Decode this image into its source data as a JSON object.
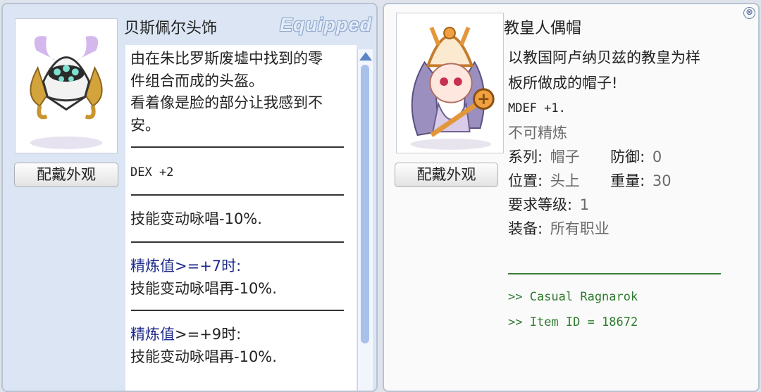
{
  "left": {
    "icon": "helmet-icon",
    "button_label": "配戴外观",
    "title": "贝斯佩尔头饰",
    "badge": "Equipped",
    "description": [
      "由在朱比罗斯废墟中找到的零",
      "件组合而成的头盔。",
      "看着像是脸的部分让我感到不",
      "安。"
    ],
    "stat": "DEX  +2",
    "effect": "技能变动咏唱-10%.",
    "refine1_label": "精炼值",
    "refine1_cond": ">=+7时:",
    "refine1_effect": "技能变动咏唱再-10%.",
    "refine2_label": "精炼值",
    "refine2_cond": ">=+9时:",
    "refine2_effect": "技能变动咏唱再-10%."
  },
  "right": {
    "icon": "pope-doll-hat-icon",
    "button_label": "配戴外观",
    "title": "教皇人偶帽",
    "description": [
      "以教国阿卢纳贝兹的教皇为样",
      "板所做成的帽子!"
    ],
    "stat": "MDEF +1.",
    "refine_note": "不可精炼",
    "type_label": "系列:",
    "type_value": "帽子",
    "defense_label": "防御:",
    "defense_value": "0",
    "location_label": "位置:",
    "location_value": "头上",
    "weight_label": "重量:",
    "weight_value": "30",
    "level_label": "要求等级:",
    "level_value": "1",
    "jobs_label": "装备:",
    "jobs_value": "所有职业",
    "link1": ">> Casual Ragnarok",
    "link2": ">> Item ID = 18672",
    "close": "⊗"
  },
  "colors": {
    "left_bg": "#dbe5f4",
    "right_bg": "#fafafa",
    "refine_text": "#1d2a8a",
    "link_text": "#2f7a2f",
    "scroll_thumb": "#a7c1ea"
  }
}
